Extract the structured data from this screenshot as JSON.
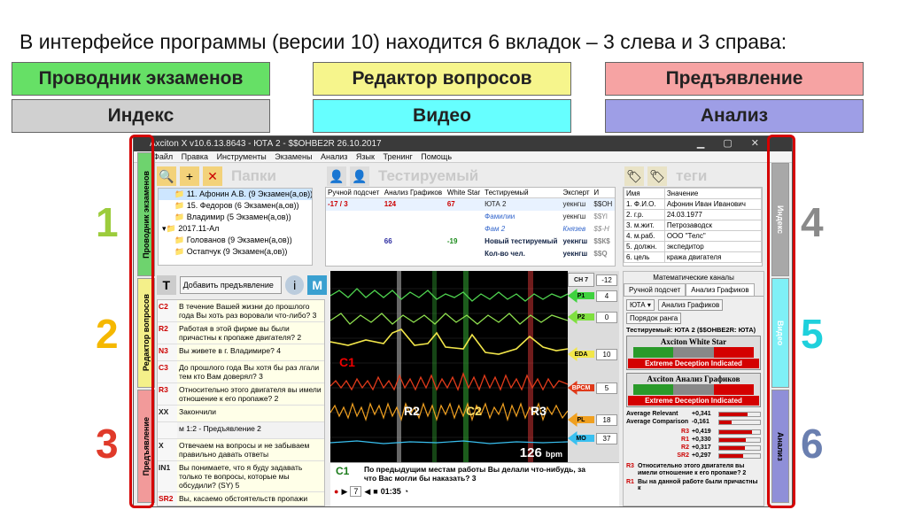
{
  "headline": "В интерфейсе программы (версии 10) находится 6 вкладок –  3 слева и 3 справа:",
  "tab_labels": [
    {
      "text": "Проводник экзаменов",
      "color": "#66e066"
    },
    {
      "text": "Редактор вопросов",
      "color": "#f6f58c"
    },
    {
      "text": "Предъявление",
      "color": "#f6a3a3"
    },
    {
      "text": "Индекс",
      "color": "#d0d0d0"
    },
    {
      "text": "Видео",
      "color": "#66ffff"
    },
    {
      "text": "Анализ",
      "color": "#9e9ee6"
    }
  ],
  "numbers": {
    "n1": "1",
    "n2": "2",
    "n3": "3",
    "n4": "4",
    "n5": "5",
    "n6": "6"
  },
  "app": {
    "title": "Axciton X v10.6.13.8643 - ЮТА 2 - $$ОНВЕ2R 26.10.2017",
    "menu": [
      "Файл",
      "Правка",
      "Инструменты",
      "Экзамены",
      "Анализ",
      "Язык",
      "Тренинг",
      "Помощь"
    ],
    "left_tabs": [
      "Проводник экзаменов",
      "Редактор вопросов",
      "Предъявление"
    ],
    "right_tabs": [
      "Индекс",
      "Видео",
      "Анализ"
    ],
    "folders_heading": "Папки",
    "tested_heading": "Тестируемый",
    "tags_heading": "теги",
    "tree": [
      "11. Афонин А.В. (9 Экзамен(а,ов))",
      "15. Федоров (6 Экзамен(а,ов))",
      "Владимир (5 Экзамен(а,ов))",
      "2017.11-Ал",
      "Голованов (9 Экзамен(а,ов))",
      "Остапчук (9 Экзамен(а,ов))"
    ],
    "tested_cols": [
      "Ручной подсчет",
      "Анализ Графиков",
      "White Star",
      "Тестируемый",
      "Эксперт",
      "И"
    ],
    "tested_rows": [
      [
        "-17 / 3",
        "124",
        "67",
        "ЮТА 2",
        "уекнгш",
        "$$ОН"
      ],
      [
        "",
        "",
        "",
        "Фамилии",
        "уекнгш",
        "$$ҮІ"
      ],
      [
        "",
        "",
        "",
        "Фам 2",
        "Князев",
        "$$-Н"
      ],
      [
        "",
        "66",
        "-19",
        "Новый тестируемый",
        "уекнгш",
        "$$К$"
      ],
      [
        "",
        "",
        "",
        "Кол-во чел.",
        "уекнгш",
        "$$Q"
      ]
    ],
    "tags_cols": [
      "Имя",
      "Значение"
    ],
    "tags_rows": [
      [
        "1. Ф.И.О.",
        "Афонин Иван Иванович"
      ],
      [
        "2. г.р.",
        "24.03.1977"
      ],
      [
        "3. м.жит.",
        "Петрозаводск"
      ],
      [
        "4. м.раб.",
        "ООО \"Телс\""
      ],
      [
        "5. должн.",
        "экспедитор"
      ],
      [
        "6. цель",
        "кража двигателя"
      ]
    ],
    "add_presentation": "Добавить предъявление",
    "questions": [
      {
        "code": "C2",
        "text": "В течение Вашей жизни до прошлого года Вы хоть раз воровали что-либо? 3"
      },
      {
        "code": "R2",
        "text": "Работая в этой фирме вы были причастны к пропаже двигателя? 2"
      },
      {
        "code": "N3",
        "text": "Вы живете в г. Владимире? 4"
      },
      {
        "code": "C3",
        "text": "До прошлого года Вы хотя бы раз лгали тем кто Вам доверял? 3"
      },
      {
        "code": "R3",
        "text": "Относительно этого двигателя вы имели отношение к его пропаже? 2"
      },
      {
        "code": "XX",
        "text": "Закончили"
      },
      {
        "code": "",
        "text": "м 1:2 - Предъявление 2"
      },
      {
        "code": "X",
        "text": "Отвечаем на вопросы и не забываем правильно давать ответы"
      },
      {
        "code": "IN1",
        "text": "Вы понимаете, что я буду задавать только те вопросы, которые мы обсудили? (SY) 5"
      },
      {
        "code": "SR2",
        "text": "Вы, касаемо обстоятельств пропажи"
      }
    ],
    "channels": [
      {
        "name": "CH 7",
        "value": "-12"
      },
      {
        "name": "P1",
        "value": "4"
      },
      {
        "name": "P2",
        "value": "0"
      },
      {
        "name": "EDA",
        "value": "10"
      },
      {
        "name": "BPCM",
        "value": "5"
      },
      {
        "name": "PL",
        "value": "18"
      },
      {
        "name": "MO",
        "value": "37"
      }
    ],
    "bpm": "126",
    "bpm_unit": "bpm",
    "chart_markers": [
      "C1",
      "R2",
      "C2",
      "R3"
    ],
    "current_code": "C1",
    "current_question": "По предыдущим местам работы Вы делали что-нибудь, за что Вас могли бы наказать? 3",
    "timer": "01:35",
    "step": "7",
    "analysis": {
      "math_channels": "Математические каналы",
      "tab_manual": "Ручной подсчет",
      "tab_graphs": "Анализ Графиков",
      "select": "ЮТА",
      "btn_graphs": "Анализ Графиков",
      "btn_rank": "Порядок ранга",
      "tested_line": "Тестируемый: ЮТА 2 ($$ОНВЕ2R: ЮТА)",
      "meter1": "Axciton White Star",
      "meter2": "Axciton Анализ Графиков",
      "verdict": "Extreme Deception Indicated",
      "avg_relevant_label": "Average Relevant",
      "avg_relevant": "+0,341",
      "avg_comparison_label": "Average Comparison",
      "avg_comparison": "-0,161",
      "bars": [
        {
          "label": "R3",
          "value": "+0,419",
          "fill": 0.8
        },
        {
          "label": "R1",
          "value": "+0,330",
          "fill": 0.65
        },
        {
          "label": "R2",
          "value": "+0,317",
          "fill": 0.62
        },
        {
          "label": "SR2",
          "value": "+0,297",
          "fill": 0.58
        }
      ],
      "q1_code": "R3",
      "q1": "Относительно этого двигателя вы имели отношение к его пропаже? 2",
      "q2_code": "R1",
      "q2": "Вы на данной работе были причастны к"
    }
  }
}
